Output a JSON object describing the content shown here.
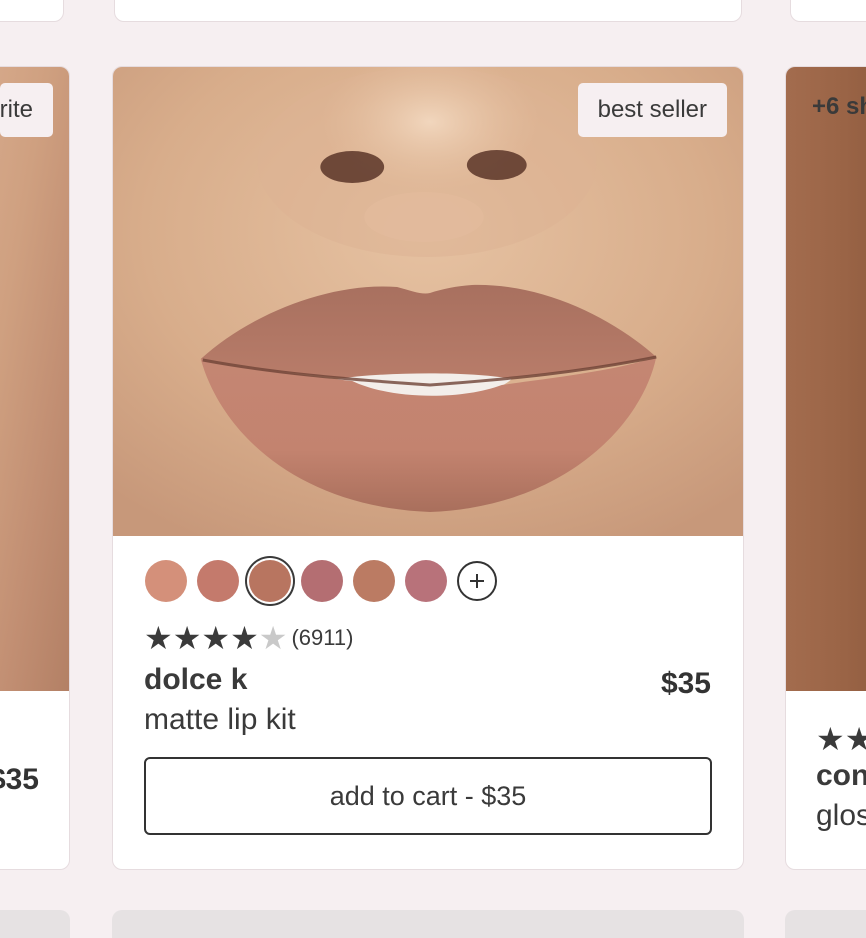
{
  "left_card": {
    "badge": "rite",
    "price": "$35"
  },
  "main_card": {
    "badge": "best seller",
    "swatches": [
      {
        "color": "#d4907a",
        "selected": false
      },
      {
        "color": "#c47a6c",
        "selected": false
      },
      {
        "color": "#b87560",
        "selected": true
      },
      {
        "color": "#b46e72",
        "selected": false
      },
      {
        "color": "#bb7b63",
        "selected": false
      },
      {
        "color": "#b8727a",
        "selected": false
      }
    ],
    "more_shades_icon": "plus-icon",
    "rating": {
      "stars": 4,
      "max_stars": 5,
      "count": "(6911)"
    },
    "name": "dolce k",
    "type": "matte lip kit",
    "price": "$35",
    "cart_label": "add to cart - $35"
  },
  "right_card": {
    "shade_count": "+6 sh",
    "name": "con",
    "type": "glos"
  },
  "colors": {
    "background": "#f6eff1",
    "card": "#ffffff",
    "text": "#3a3a3a",
    "badge_bg": "#f6eff1"
  }
}
